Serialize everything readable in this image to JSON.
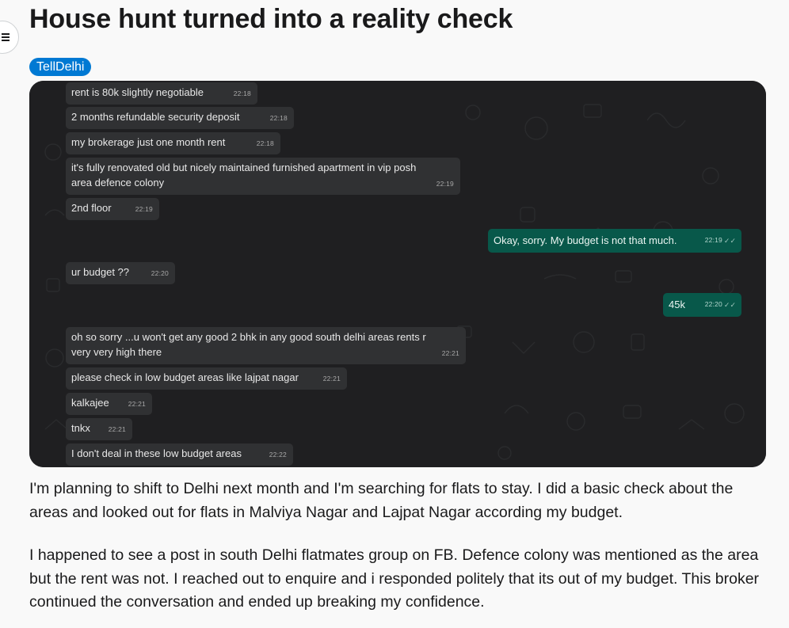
{
  "nav": {
    "menu_icon": "hamburger-icon"
  },
  "post": {
    "title": "House hunt turned into a reality check",
    "flair": "TellDelhi",
    "flair_color": "#0079d3",
    "body": [
      "I'm planning to shift to Delhi next month and I'm searching for flats to stay. I did a basic check about the areas and looked out for flats in Malviya Nagar and Lajpat Nagar according my budget.",
      "I happened to see a post in south Delhi flatmates group on FB. Defence colony was mentioned as the area but the rent was not. I reached out to enquire and i responded politely that its out of my budget. This broker continued the conversation and ended up breaking my confidence."
    ]
  },
  "chat": {
    "incoming_color": "#303133",
    "outgoing_color": "#08584a",
    "messages": [
      {
        "side": "in",
        "text": "rent is 80k  slightly negotiable",
        "time": "22:18"
      },
      {
        "side": "in",
        "text": "2 months refundable security deposit",
        "time": "22:18"
      },
      {
        "side": "in",
        "text": "my brokerage just one month rent",
        "time": "22:18"
      },
      {
        "side": "in",
        "text": "it's fully renovated old but nicely maintained  furnished apartment  in vip posh",
        "text2": "area defence colony",
        "time": "22:19"
      },
      {
        "side": "in",
        "text": "2nd floor",
        "time": "22:19"
      },
      {
        "side": "out",
        "text": "Okay, sorry. My budget is not that much.",
        "time": "22:19"
      },
      {
        "side": "in",
        "text": "ur budget ??",
        "time": "22:20"
      },
      {
        "side": "out",
        "text": "45k",
        "time": "22:20"
      },
      {
        "side": "in",
        "text": "oh  so sorry ...u won't get any good 2 bhk in any good south delhi areas   rents r",
        "text2": "very very high there",
        "time": "22:21"
      },
      {
        "side": "in",
        "text": "please check in low budget areas like lajpat nagar",
        "time": "22:21"
      },
      {
        "side": "in",
        "text": "kalkajee",
        "time": "22:21"
      },
      {
        "side": "in",
        "text": "tnkx",
        "time": "22:21"
      },
      {
        "side": "in",
        "text": "I don't deal in these low budget areas",
        "time": "22:22"
      }
    ],
    "read_ticks": "✓✓"
  }
}
